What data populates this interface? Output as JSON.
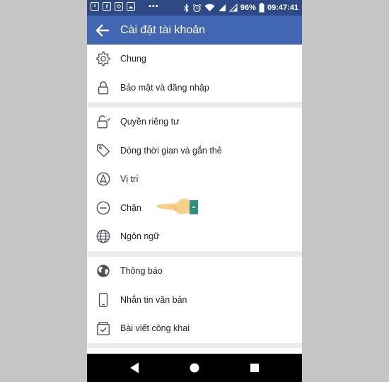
{
  "status_bar": {
    "battery": "96%",
    "time": "09:47:41"
  },
  "app_bar": {
    "title": "Cài đặt tài khoản"
  },
  "sections": [
    {
      "items": [
        {
          "label": "Chung",
          "icon": "gear-icon"
        },
        {
          "label": "Bảo mật và đăng nhập",
          "icon": "lock-icon"
        }
      ]
    },
    {
      "items": [
        {
          "label": "Quyền riêng tư",
          "icon": "privacy-lock-icon"
        },
        {
          "label": "Dòng thời gian và gắn thẻ",
          "icon": "tag-icon"
        },
        {
          "label": "Vị trí",
          "icon": "location-icon"
        },
        {
          "label": "Chặn",
          "icon": "block-icon"
        },
        {
          "label": "Ngôn ngữ",
          "icon": "globe-icon"
        }
      ]
    },
    {
      "items": [
        {
          "label": "Thông báo",
          "icon": "earth-icon"
        },
        {
          "label": "Nhắn tin văn bản",
          "icon": "phone-icon"
        },
        {
          "label": "Bài viết công khai",
          "icon": "public-post-icon"
        }
      ]
    }
  ],
  "colors": {
    "app_bar": "#4267b2",
    "status_bar": "#2e4a86",
    "background": "#e9ebee",
    "text": "#1d2129"
  }
}
